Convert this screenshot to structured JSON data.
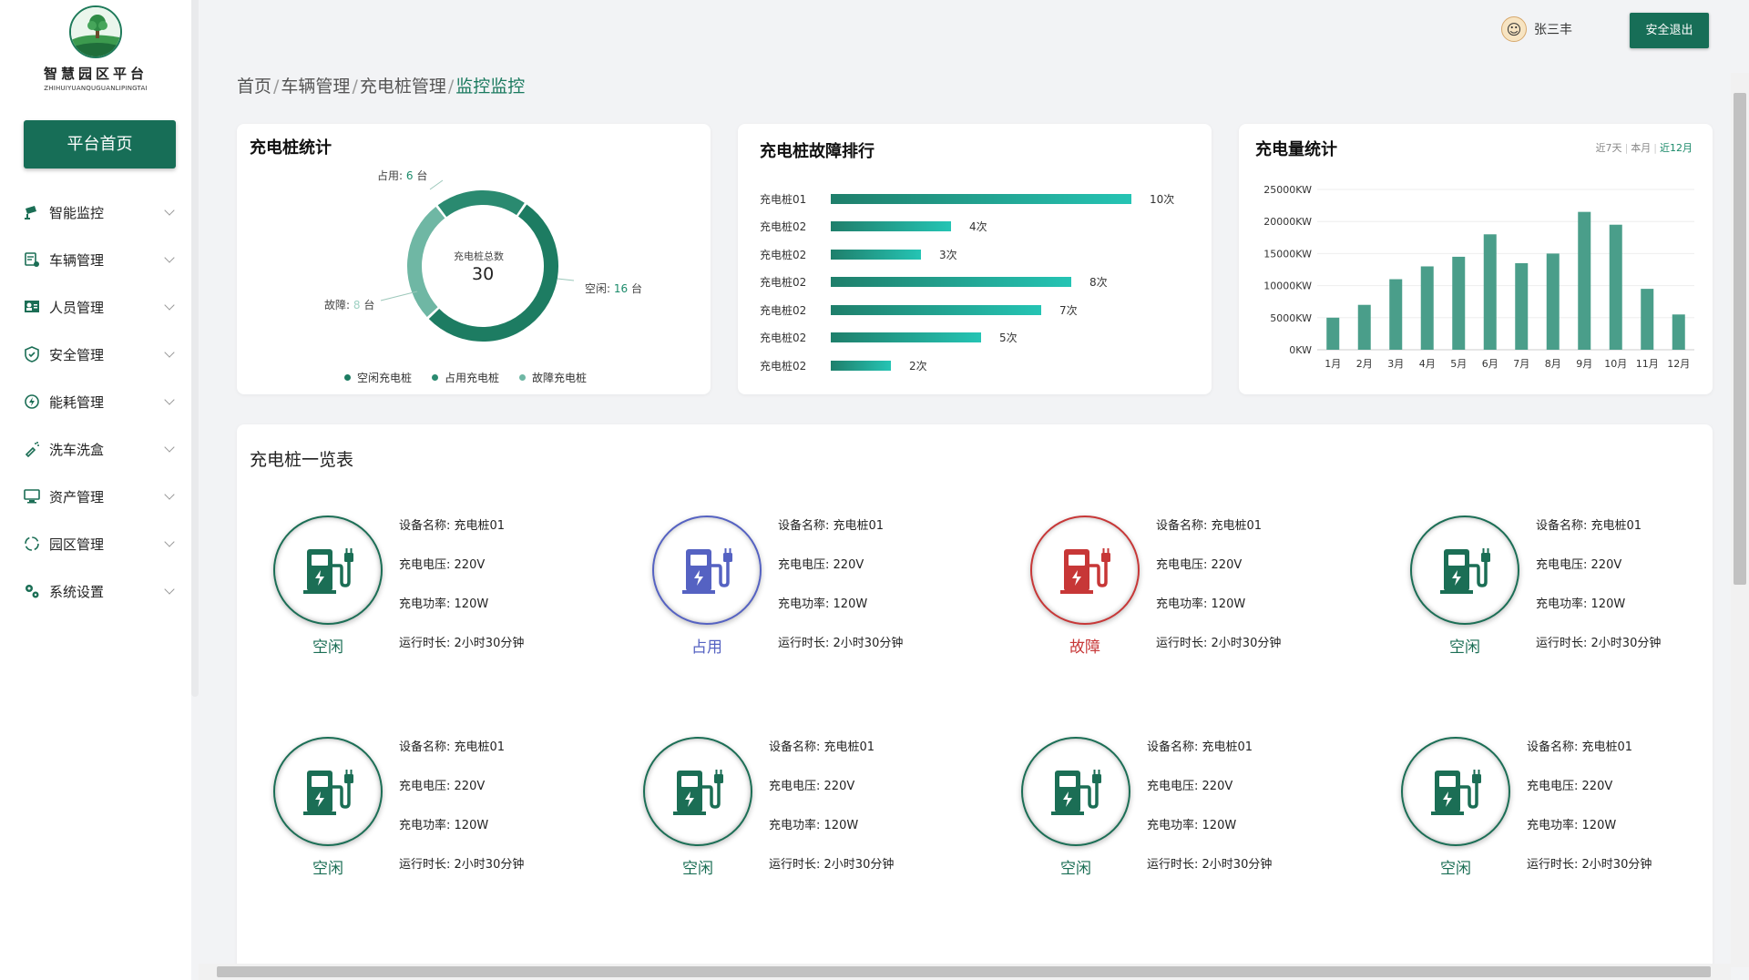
{
  "app": {
    "logo_title": "智慧园区平台",
    "logo_subtitle": "ZHIHUIYUANQUGUANLIPINGTAI",
    "home_button": "平台首页"
  },
  "sidebar": {
    "items": [
      {
        "label": "智能监控",
        "icon": "camera-icon"
      },
      {
        "label": "车辆管理",
        "icon": "car-icon"
      },
      {
        "label": "人员管理",
        "icon": "people-icon"
      },
      {
        "label": "安全管理",
        "icon": "shield-icon"
      },
      {
        "label": "能耗管理",
        "icon": "energy-icon"
      },
      {
        "label": "洗车洗盒",
        "icon": "spray-icon"
      },
      {
        "label": "资产管理",
        "icon": "monitor-icon"
      },
      {
        "label": "园区管理",
        "icon": "circle-dashed-icon"
      },
      {
        "label": "系统设置",
        "icon": "gears-icon"
      }
    ]
  },
  "header": {
    "user_name": "张三丰",
    "logout_button": "安全退出"
  },
  "breadcrumb": {
    "items": [
      "首页",
      "车辆管理",
      "充电桩管理"
    ],
    "current": "监控监控"
  },
  "stats_card": {
    "title": "充电桩统计",
    "center_label": "充电桩总数",
    "center_value": "30",
    "occupied_label": "占用:",
    "occupied_value": "6",
    "occupied_unit": "台",
    "idle_label": "空闲:",
    "idle_value": "16",
    "idle_unit": "台",
    "fault_label": "故障:",
    "fault_value": "8",
    "fault_unit": "台",
    "legend": [
      "空闲充电桩",
      "占用充电桩",
      "故障充电桩"
    ],
    "colors": {
      "idle": "#1d7c62",
      "occupied": "#2a8a70",
      "fault": "#6fb7a4"
    }
  },
  "fault_card": {
    "title": "充电桩故障排行",
    "rows": [
      {
        "name": "充电桩01",
        "count": 10,
        "label": "10次"
      },
      {
        "name": "充电桩02",
        "count": 4,
        "label": "4次"
      },
      {
        "name": "充电桩02",
        "count": 3,
        "label": "3次"
      },
      {
        "name": "充电桩02",
        "count": 8,
        "label": "8次"
      },
      {
        "name": "充电桩02",
        "count": 7,
        "label": "7次"
      },
      {
        "name": "充电桩02",
        "count": 5,
        "label": "5次"
      },
      {
        "name": "充电桩02",
        "count": 2,
        "label": "2次"
      }
    ]
  },
  "energy_card": {
    "title": "充电量统计",
    "range_tabs": [
      "近7天",
      "本月",
      "近12月"
    ],
    "active_range": "近12月"
  },
  "chart_data": {
    "type": "bar",
    "categories": [
      "1月",
      "2月",
      "3月",
      "4月",
      "5月",
      "6月",
      "7月",
      "8月",
      "9月",
      "10月",
      "11月",
      "12月"
    ],
    "values": [
      5000,
      7000,
      11000,
      13000,
      14500,
      18000,
      13500,
      15000,
      21500,
      19500,
      9500,
      5500
    ],
    "ylim": [
      0,
      25000
    ],
    "yticks": [
      "0KW",
      "5000KW",
      "10000KW",
      "15000KW",
      "20000KW",
      "25000KW"
    ],
    "color": "#4a9e8a",
    "grid": true
  },
  "pile_list": {
    "title": "充电桩一览表",
    "field_labels": {
      "name": "设备名称:",
      "voltage": "充电电压:",
      "power": "充电功率:",
      "runtime": "运行时长:"
    },
    "items": [
      {
        "status": "空闲",
        "state": "idle",
        "name": "充电桩01",
        "voltage": "220V",
        "power": "120W",
        "runtime": "2小时30分钟"
      },
      {
        "status": "占用",
        "state": "occupied",
        "name": "充电桩01",
        "voltage": "220V",
        "power": "120W",
        "runtime": "2小时30分钟"
      },
      {
        "status": "故障",
        "state": "fault",
        "name": "充电桩01",
        "voltage": "220V",
        "power": "120W",
        "runtime": "2小时30分钟"
      },
      {
        "status": "空闲",
        "state": "idle",
        "name": "充电桩01",
        "voltage": "220V",
        "power": "120W",
        "runtime": "2小时30分钟"
      },
      {
        "status": "空闲",
        "state": "idle",
        "name": "充电桩01",
        "voltage": "220V",
        "power": "120W",
        "runtime": "2小时30分钟"
      },
      {
        "status": "空闲",
        "state": "idle",
        "name": "充电桩01",
        "voltage": "220V",
        "power": "120W",
        "runtime": "2小时30分钟"
      },
      {
        "status": "空闲",
        "state": "idle",
        "name": "充电桩01",
        "voltage": "220V",
        "power": "120W",
        "runtime": "2小时30分钟"
      },
      {
        "status": "空闲",
        "state": "idle",
        "name": "充电桩01",
        "voltage": "220V",
        "power": "120W",
        "runtime": "2小时30分钟"
      }
    ],
    "state_colors": {
      "idle": "#1b6e55",
      "occupied": "#5562c2",
      "fault": "#c73737"
    }
  }
}
